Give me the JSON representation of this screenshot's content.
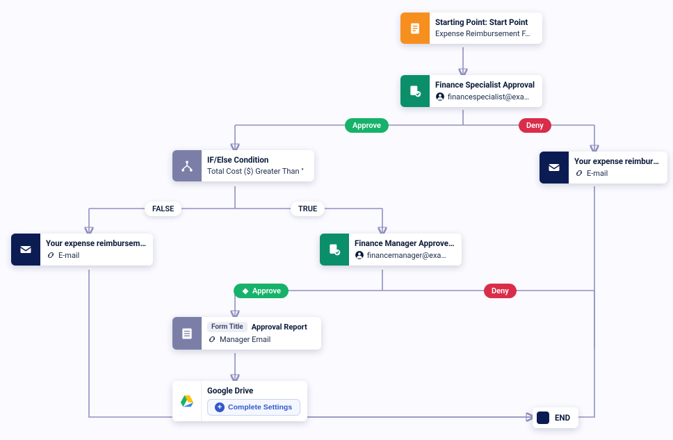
{
  "colors": {
    "approve": "#17b26a",
    "deny": "#d92d4a",
    "connector": "#8f8fc0",
    "orange": "#f78f1e",
    "teal": "#0a8f6a",
    "slate": "#7b7fa8",
    "navy": "#0b1c53"
  },
  "nodes": {
    "start": {
      "title": "Starting Point: Start Point",
      "subtitle": "Expense Reimbursement F…",
      "icon": "document-icon"
    },
    "financeSpecialist": {
      "title": "Finance Specialist Approval",
      "subtitle": "financespecialist@exa…",
      "icon": "approval-icon"
    },
    "ifelse": {
      "title": "IF/Else Condition",
      "subtitle": "Total Cost ($) Greater Than \"",
      "icon": "branch-icon"
    },
    "denyEmail1": {
      "title": "Your expense reimbursement…",
      "subtitle": "E-mail",
      "icon": "mail-icon"
    },
    "emailFalse": {
      "title": "Your expense reimbursement…",
      "subtitle": "E-mail",
      "icon": "mail-icon"
    },
    "financeManager": {
      "title": "Finance Manager Approve & …",
      "subtitle": "financemanager@exa…",
      "icon": "approval-icon"
    },
    "approvalReport": {
      "tag": "Form Title",
      "formTitle": "Approval Report",
      "subtitle": "Manager Email",
      "icon": "spreadsheet-icon"
    },
    "googleDrive": {
      "title": "Google Drive",
      "button": "Complete Settings",
      "icon": "google-drive-icon"
    },
    "end": {
      "label": "END"
    }
  },
  "badges": {
    "approve1": "Approve",
    "deny1": "Deny",
    "false": "FALSE",
    "true": "TRUE",
    "approve2": "Approve",
    "deny2": "Deny"
  }
}
